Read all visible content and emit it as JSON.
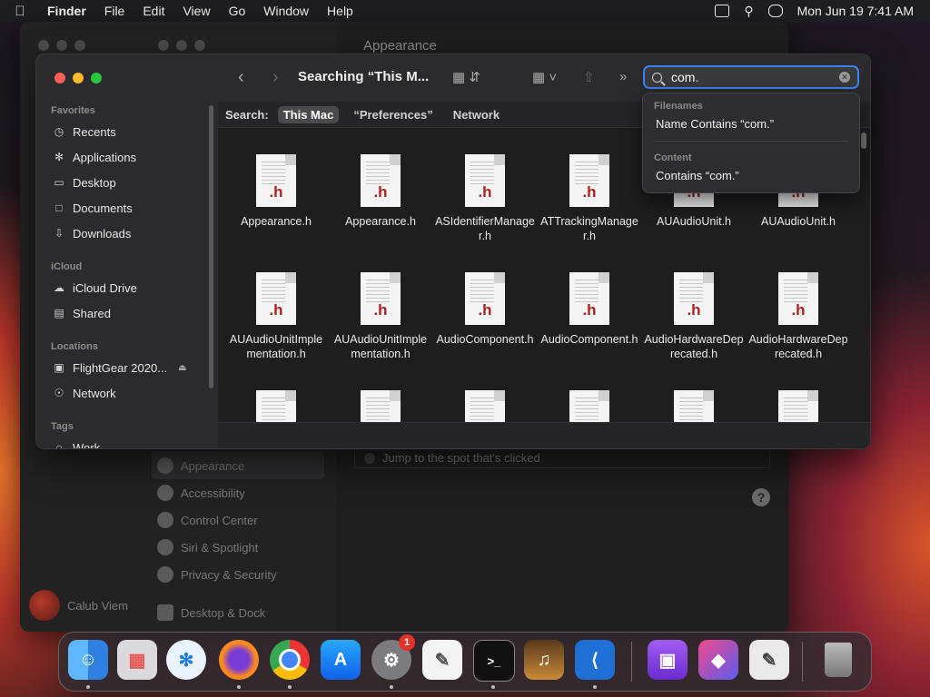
{
  "menubar": {
    "app": "Finder",
    "items": [
      "File",
      "Edit",
      "View",
      "Go",
      "Window",
      "Help"
    ],
    "datetime": "Mon Jun 19  7:41 AM"
  },
  "settings": {
    "title": "Appearance",
    "sidebar": [
      "Appearance",
      "Accessibility",
      "Control Center",
      "Siri & Spotlight",
      "Privacy & Security",
      "Desktop & Dock"
    ],
    "option": "Jump to the spot that's clicked",
    "user": "Calub Viem",
    "help": "?"
  },
  "finder": {
    "title": "Searching “This M...",
    "sections": {
      "favorites": "Favorites",
      "icloud": "iCloud",
      "locations": "Locations",
      "tags": "Tags"
    },
    "favorites": [
      "Recents",
      "Applications",
      "Desktop",
      "Documents",
      "Downloads"
    ],
    "icloud": [
      "iCloud Drive",
      "Shared"
    ],
    "locations": [
      "FlightGear 2020...",
      "Network"
    ],
    "tags": [
      "Work"
    ],
    "search": {
      "value": "com.",
      "scope_label": "Search:",
      "scopes": [
        "This Mac",
        "“Preferences”",
        "Network"
      ]
    },
    "files": [
      {
        "name": "Appearance.h",
        "ext": ".h"
      },
      {
        "name": "Appearance.h",
        "ext": ".h"
      },
      {
        "name": "ASIdentifierManager.h",
        "ext": ".h"
      },
      {
        "name": "ATTrackingManager.h",
        "ext": ".h"
      },
      {
        "name": "AUAudioUnit.h",
        "ext": ".h"
      },
      {
        "name": "AUAudioUnit.h",
        "ext": ".h"
      },
      {
        "name": "AUAudioUnitImplementation.h",
        "ext": ".h"
      },
      {
        "name": "AUAudioUnitImplementation.h",
        "ext": ".h"
      },
      {
        "name": "AudioComponent.h",
        "ext": ".h"
      },
      {
        "name": "AudioComponent.h",
        "ext": ".h"
      },
      {
        "name": "AudioHardwareDeprecated.h",
        "ext": ".h"
      },
      {
        "name": "AudioHardwareDeprecated.h",
        "ext": ".h"
      }
    ],
    "suggestions": {
      "filenames_header": "Filenames",
      "filenames_item": "Name Contains “com.”",
      "content_header": "Content",
      "content_item": "Contains “com.”"
    }
  },
  "dock": {
    "settings_badge": "1",
    "terminal_glyph": ">_"
  },
  "colors": {
    "accent": "#3b82f6",
    "badge": "#e5332a"
  }
}
